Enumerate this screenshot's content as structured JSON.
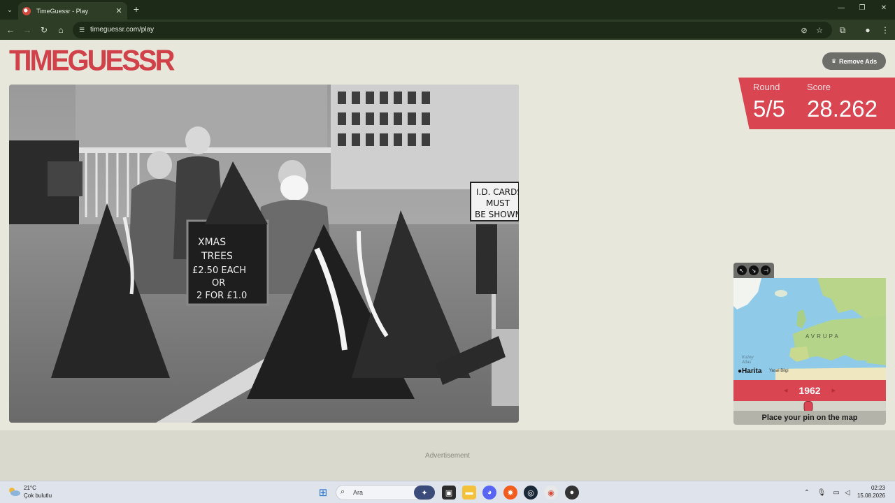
{
  "browser": {
    "tab_title": "TimeGuessr - Play",
    "url": "timeguessr.com/play"
  },
  "page": {
    "logo_text": "TIMEGUESSR",
    "remove_ads_label": "Remove Ads",
    "round_label": "Round",
    "round_value": "5/5",
    "score_label": "Score",
    "score_value": "28.262",
    "photo_sign_text": [
      "I.D. CARDS",
      "MUST",
      "BE SHOWN"
    ],
    "chalkboard_text": [
      "XMAS",
      "TREES",
      "£2.50 EACH",
      "OR",
      "2 FOR £1.0"
    ],
    "map": {
      "continent_label": "AVRUPA",
      "ocean_label_1": "Kuzey",
      "ocean_label_2": "Atlas",
      "provider_label": "Harita",
      "legal_label": "Yasal Bilgi"
    },
    "year_value": "1962",
    "year_slider_fraction": 0.49,
    "pin_instruction": "Place your pin on the map",
    "ad_label": "Advertisement"
  },
  "taskbar": {
    "weather_temp": "21°C",
    "weather_condition": "Çok bulutlu",
    "search_placeholder": "Ara",
    "clock_time": "02:23",
    "clock_date": "15.08.2026"
  },
  "colors": {
    "accent_red": "#d94551",
    "page_bg": "#e8e7dc",
    "chrome_dark": "#1c2a17"
  }
}
